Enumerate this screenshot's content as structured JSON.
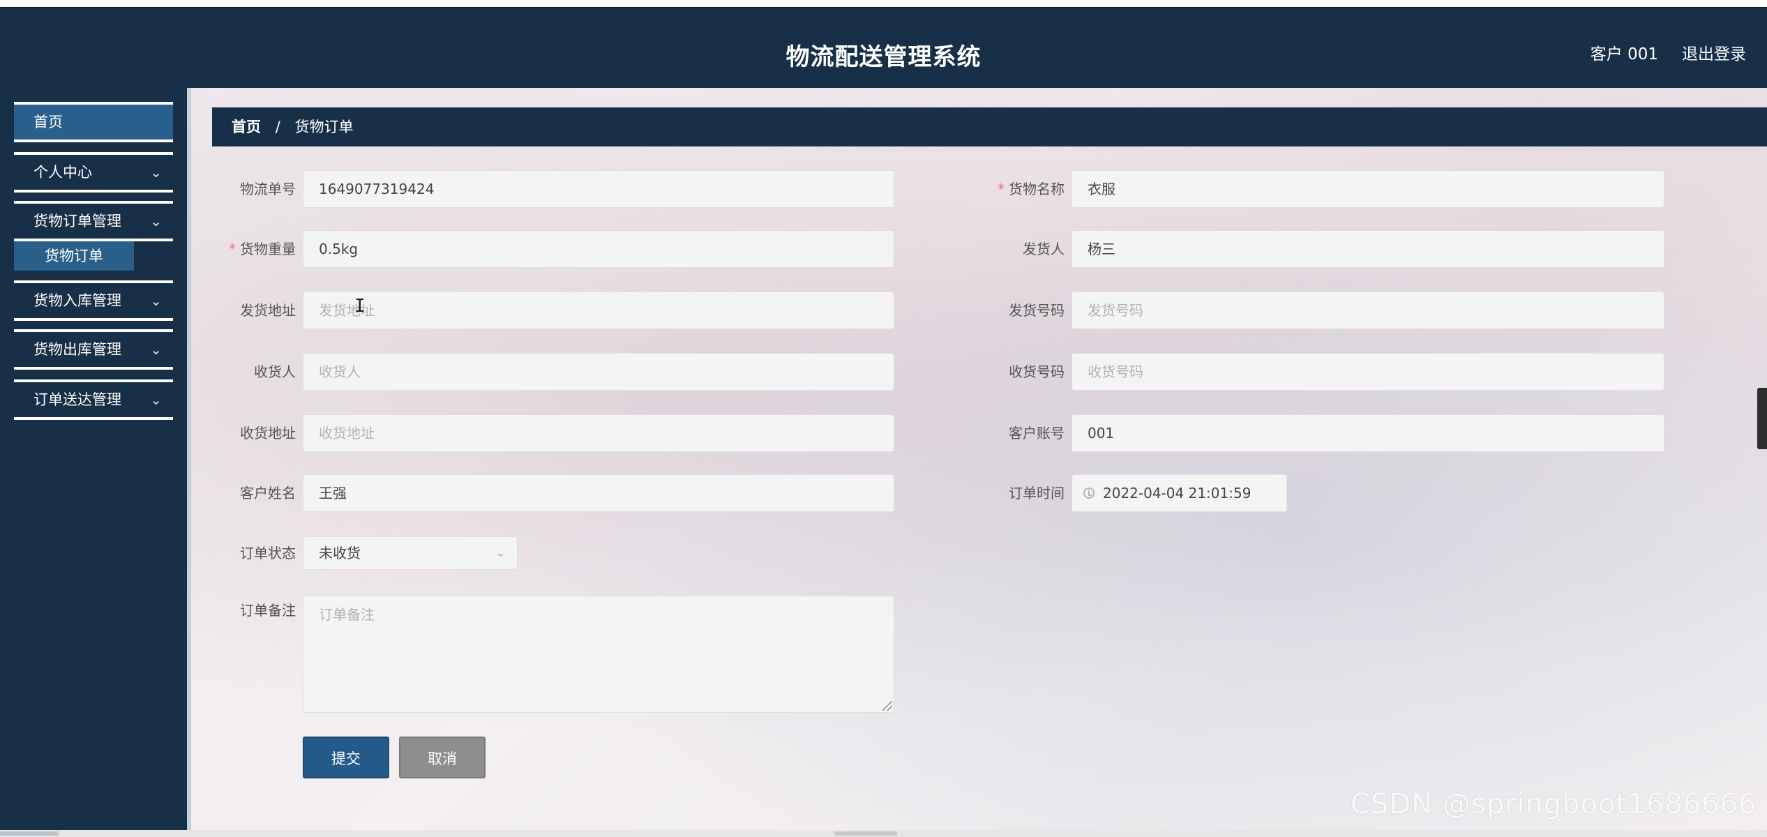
{
  "header": {
    "title": "物流配送管理系统",
    "user_label": "客户 001",
    "logout_label": "退出登录"
  },
  "sidebar": {
    "items": [
      {
        "label": "首页"
      },
      {
        "label": "个人中心"
      },
      {
        "label": "货物订单管理"
      },
      {
        "label": "货物入库管理"
      },
      {
        "label": "货物出库管理"
      },
      {
        "label": "订单送达管理"
      }
    ],
    "sub_item": "货物订单",
    "chevron": "chevron-down-icon"
  },
  "breadcrumb": {
    "home": "首页",
    "separator": "/",
    "current": "货物订单"
  },
  "form": {
    "tracking_no": {
      "label": "物流单号",
      "value": "1649077319424"
    },
    "goods_name": {
      "label": "货物名称",
      "value": "衣服",
      "required": "*"
    },
    "weight": {
      "label": "货物重量",
      "value": "0.5kg",
      "required": "*"
    },
    "sender": {
      "label": "发货人",
      "value": "杨三"
    },
    "send_address": {
      "label": "发货地址",
      "placeholder": "发货地址"
    },
    "send_phone": {
      "label": "发货号码",
      "placeholder": "发货号码"
    },
    "receiver": {
      "label": "收货人",
      "placeholder": "收货人"
    },
    "receive_phone": {
      "label": "收货号码",
      "placeholder": "收货号码"
    },
    "receive_address": {
      "label": "收货地址",
      "placeholder": "收货地址"
    },
    "customer_account": {
      "label": "客户账号",
      "value": "001"
    },
    "customer_name": {
      "label": "客户姓名",
      "value": "王强"
    },
    "order_time": {
      "label": "订单时间",
      "value": "2022-04-04 21:01:59"
    },
    "order_status": {
      "label": "订单状态",
      "value": "未收货"
    },
    "order_note": {
      "label": "订单备注",
      "placeholder": "订单备注"
    },
    "submit_label": "提交",
    "cancel_label": "取消"
  },
  "watermark": "CSDN @springboot1686666",
  "colors": {
    "header_bg": "#173048",
    "active_menu": "#285f8c",
    "submit_btn": "#245a88",
    "cancel_btn": "#8e8e8e",
    "required_mark": "#f56c6c"
  }
}
